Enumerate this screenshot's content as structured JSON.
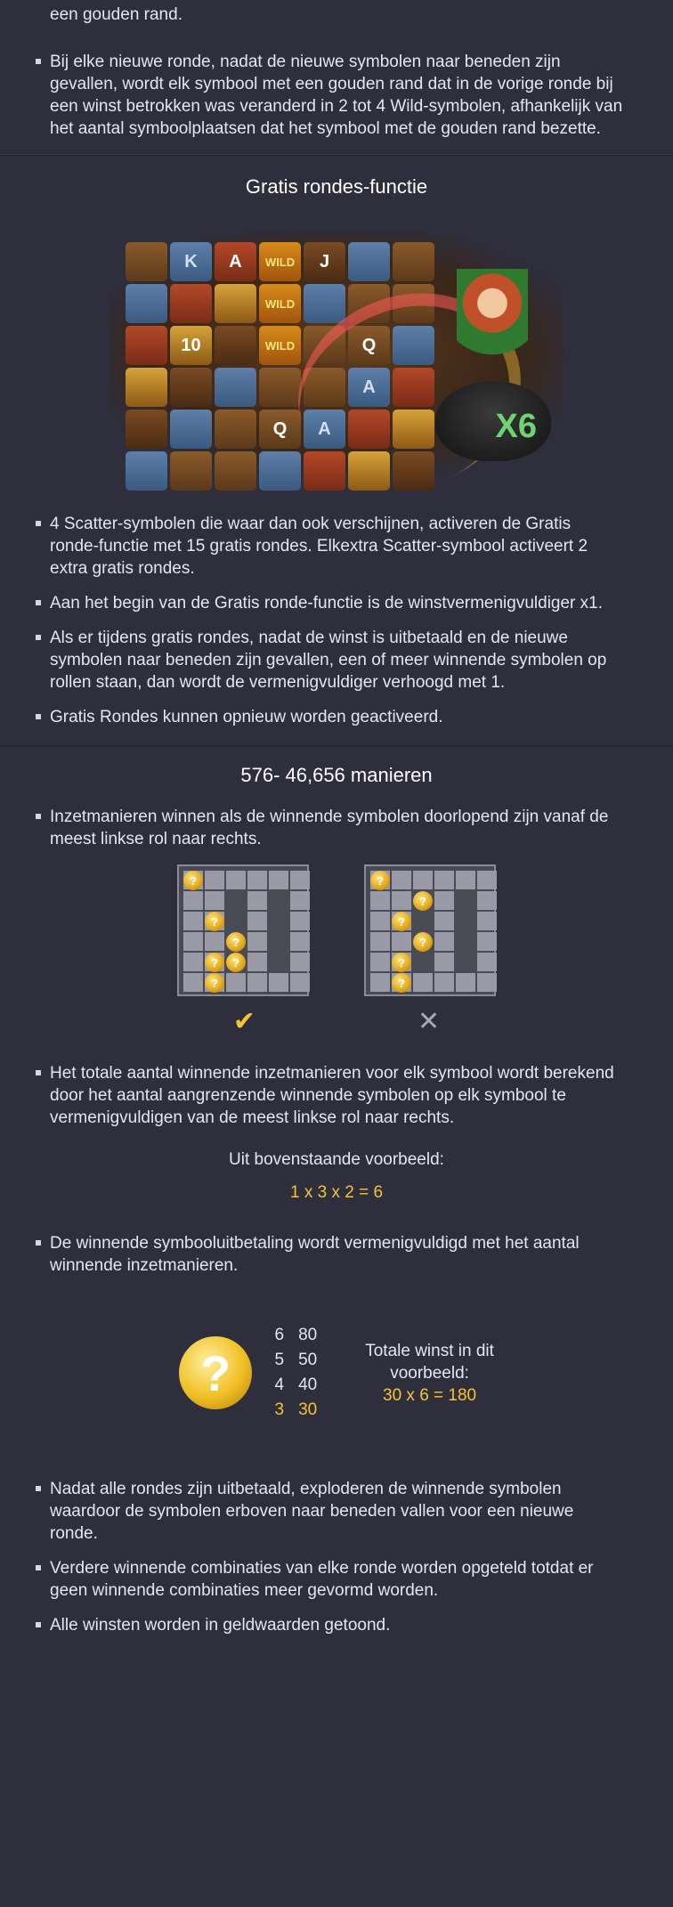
{
  "top": {
    "partial_line": "een gouden rand.",
    "bullets": [
      "Bij elke nieuwe ronde, nadat de nieuwe symbolen naar beneden zijn gevallen, wordt elk symbool met een gouden rand dat in de vorige ronde bij een winst betrokken was veranderd in 2 tot 4 Wild-symbolen, afhankelijk van het aantal symboolplaatsen dat het symbool met de gouden rand bezette."
    ]
  },
  "free_spins": {
    "title": "Gratis rondes-functie",
    "reel_symbols": [
      [
        "",
        "K",
        "A",
        "WILD",
        "J",
        "",
        ""
      ],
      [
        "",
        "",
        "",
        "WILD",
        "",
        "",
        ""
      ],
      [
        "",
        "10",
        "",
        "WILD",
        "",
        "Q",
        ""
      ],
      [
        "",
        "",
        "",
        "",
        "",
        "A",
        ""
      ],
      [
        "",
        "",
        "",
        "Q",
        "A",
        "",
        ""
      ],
      [
        "",
        "",
        "",
        "",
        "",
        "",
        ""
      ]
    ],
    "multiplier_text": "X6",
    "bullets": [
      "4 Scatter-symbolen die waar dan ook verschijnen, activeren de Gratis ronde-functie met 15 gratis rondes. Elkextra Scatter-symbool activeert 2 extra gratis rondes.",
      "Aan het begin van de Gratis ronde-functie is de winstvermenigvuldiger x1.",
      "Als er tijdens gratis rondes, nadat de winst is uitbetaald en de nieuwe symbolen naar beneden zijn gevallen, een of meer winnende symbolen op rollen staan, dan wordt de vermenigvuldiger verhoogd met 1.",
      "Gratis Rondes kunnen opnieuw worden geactiveerd."
    ]
  },
  "ways": {
    "title": "576- 46,656 manieren",
    "bullets_1": [
      "Inzetmanieren winnen als de winnende symbolen doorlopend zijn vanaf de meest linkse rol naar rechts."
    ],
    "coin_glyph": "?",
    "check_glyph": "✔",
    "cross_glyph": "✕",
    "bullets_2": [
      "Het totale aantal winnende inzetmanieren voor elk symbool wordt berekend door het aantal aangrenzende winnende symbolen op elk symbool te vermenigvuldigen van de meest linkse rol naar rechts."
    ],
    "example_label": "Uit bovenstaande voorbeeld:",
    "example_formula": "1 x 3 x 2 = 6",
    "bullets_3": [
      "De winnende symbooluitbetaling wordt vermenigvuldigd met het aantal winnende inzetmanieren."
    ],
    "paytable": [
      {
        "n": "6",
        "v": "80"
      },
      {
        "n": "5",
        "v": "50"
      },
      {
        "n": "4",
        "v": "40"
      },
      {
        "n": "3",
        "v": "30"
      }
    ],
    "total_label_1": "Totale winst in dit",
    "total_label_2": "voorbeeld:",
    "total_formula": "30 x 6 = 180",
    "bullets_4": [
      "Nadat alle rondes zijn uitbetaald, exploderen de winnende symbolen waardoor de symbolen erboven naar beneden vallen voor een nieuwe ronde.",
      "Verdere winnende combinaties van elke ronde worden opgeteld totdat er geen winnende combinaties meer gevormd worden.",
      "Alle winsten worden in geldwaarden getoond."
    ]
  },
  "colors": {
    "background": "#2e2e3c",
    "accent_gold": "#f5c431",
    "text": "#e6e6ee"
  }
}
